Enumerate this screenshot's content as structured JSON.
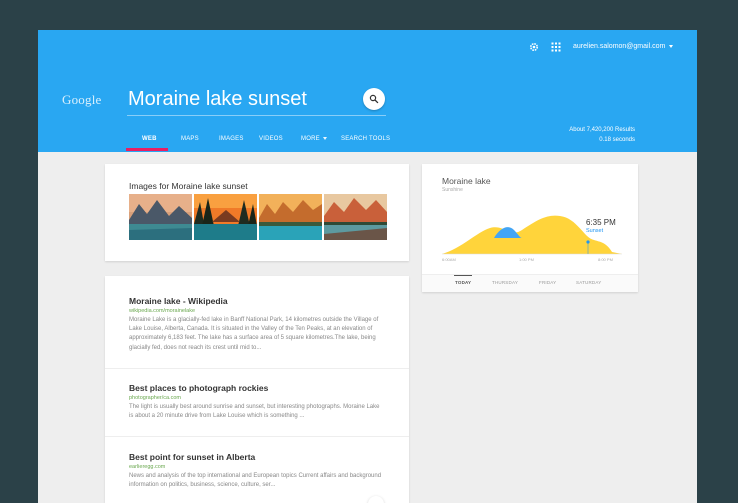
{
  "header": {
    "logo": "Google",
    "account_email": "aurelien.salomon@gmail.com",
    "search_query": "Moraine lake sunset",
    "icons": [
      "gear-icon",
      "apps-icon",
      "search-icon",
      "chevron-down-icon"
    ],
    "tabs": [
      {
        "label": "WEB",
        "active": true
      },
      {
        "label": "MAPS",
        "active": false
      },
      {
        "label": "IMAGES",
        "active": false
      },
      {
        "label": "VIDEOS",
        "active": false
      },
      {
        "label": "MORE",
        "active": false
      },
      {
        "label": "SEARCH TOOLS",
        "active": false
      }
    ],
    "results_count": "About 7,420,200 Results",
    "results_time": "0.18 seconds"
  },
  "images": {
    "title": "Images for Moraine lake sunset"
  },
  "results": [
    {
      "title": "Moraine lake - Wikipedia",
      "url": "wikipedia.com/morainelake",
      "snippet": "Moraine Lake is a glacially-fed lake in Banff National Park, 14 kilometres outside the Village of Lake Louise, Alberta, Canada. It is situated in the Valley of the Ten Peaks, at an elevation of approximately 6,183 feet. The lake has a surface area of 5 square kilometres.The lake, being glacially fed, does not reach its crest until mid to..."
    },
    {
      "title": "Best places to photograph rockies",
      "url": "photographer/ca.com",
      "snippet": "The light is usually best around sunrise and sunset, but interesting photographs. Moraine Lake is about a 20 minute drive from Lake Louise which is something ..."
    },
    {
      "title": "Best point for sunset in Alberta",
      "url": "earlieregg.com",
      "snippet": "News and analysis of the top international and European topics Current affairs and background information on politics, business, science, culture, ser..."
    }
  ],
  "weather": {
    "title": "Moraine lake",
    "subtitle": "Sunshine",
    "time": "6:35 PM",
    "time_label": "Sunset",
    "axis_labels": [
      "6:00AM",
      "1:00 PM",
      "8:00 PM"
    ],
    "day_tabs": [
      {
        "label": "TODAY",
        "active": true
      },
      {
        "label": "THURSDAY",
        "active": false
      },
      {
        "label": "FRIDAY",
        "active": false
      },
      {
        "label": "SATURDAY",
        "active": false
      }
    ],
    "colors": {
      "sun": "#ffd43b",
      "cloud": "#42a5f5"
    }
  },
  "colors": {
    "header": "#29a7f2",
    "tab_indicator": "#e91e63",
    "url_green": "#6aa84f",
    "background": "#2b4148"
  }
}
